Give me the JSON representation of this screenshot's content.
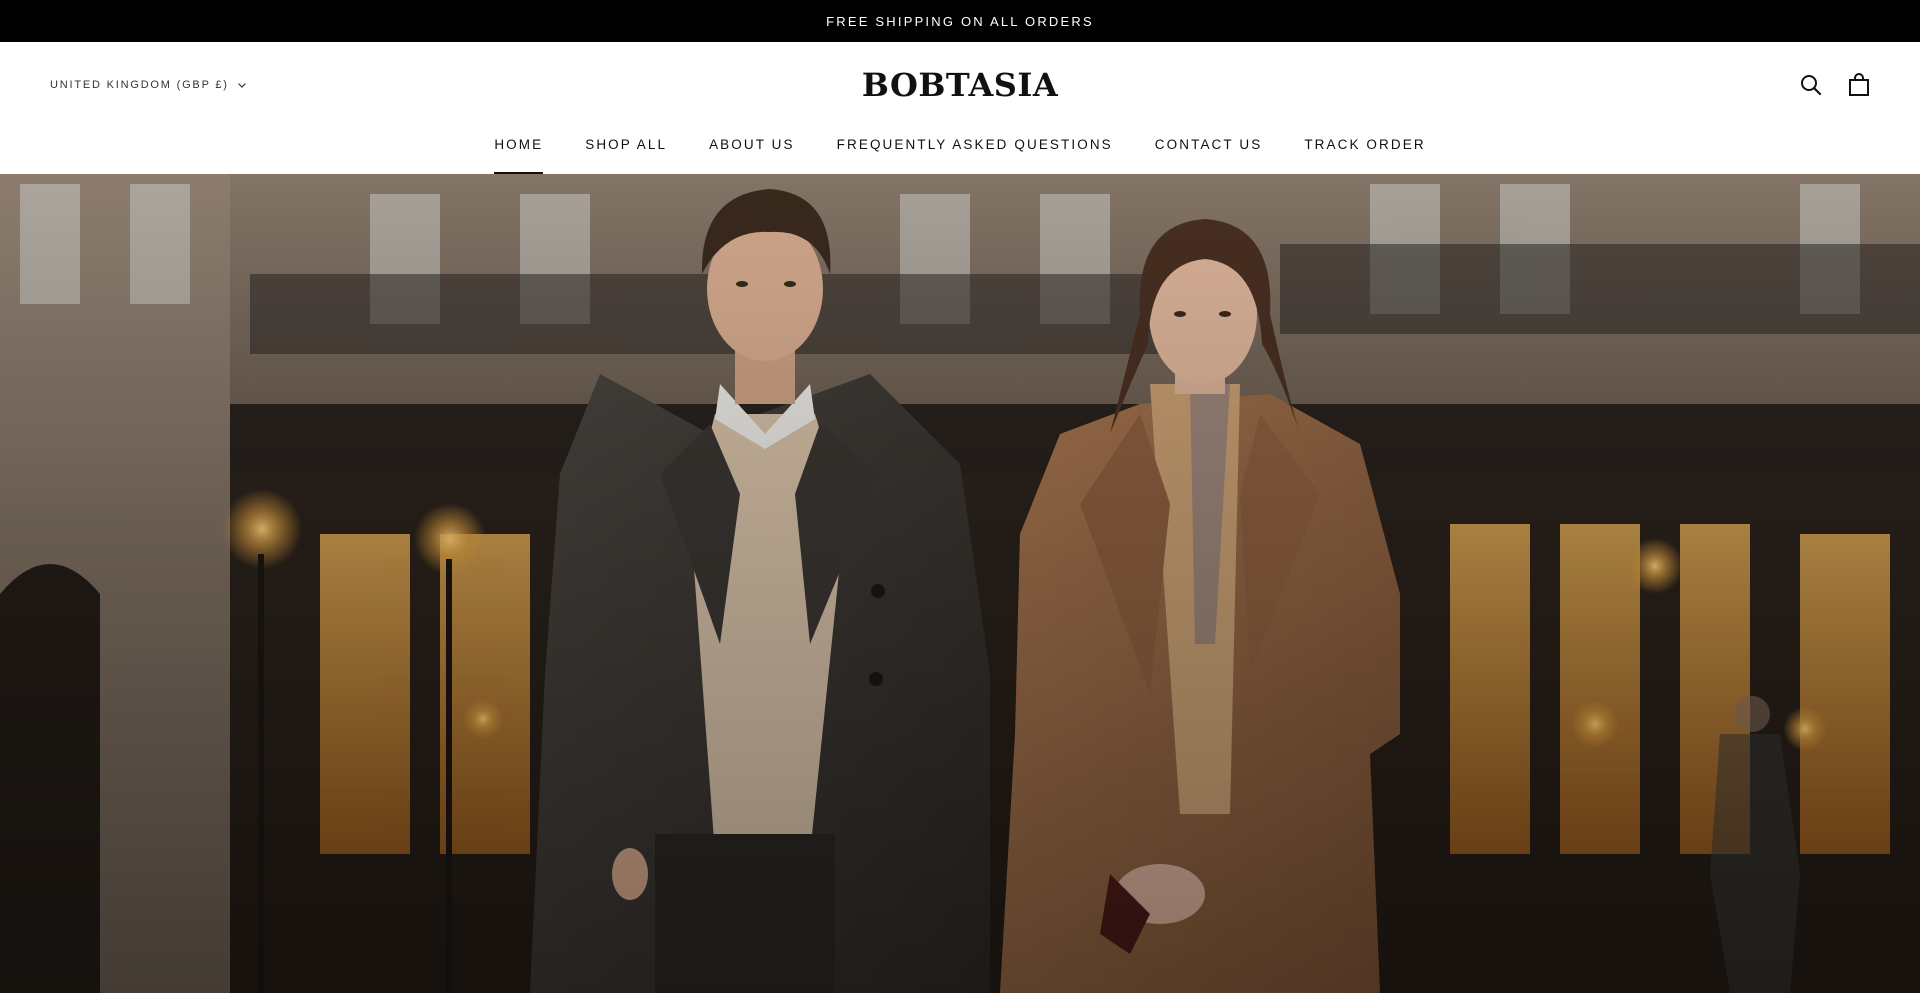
{
  "announcement": {
    "text": "FREE SHIPPING ON ALL ORDERS"
  },
  "header": {
    "currency_selector": "UNITED KINGDOM (GBP £)",
    "logo": "BOBTASIA",
    "icons": [
      "search-icon",
      "cart-icon"
    ]
  },
  "nav": {
    "items": [
      {
        "label": "HOME",
        "active": true
      },
      {
        "label": "SHOP ALL",
        "active": false
      },
      {
        "label": "ABOUT US",
        "active": false
      },
      {
        "label": "FREQUENTLY ASKED QUESTIONS",
        "active": false
      },
      {
        "label": "CONTACT US",
        "active": false
      },
      {
        "label": "TRACK ORDER",
        "active": false
      }
    ]
  },
  "hero": {
    "image_description": "man and woman in winter coats on city street",
    "colors": {
      "mans_coat": "#3a3632",
      "womans_coat": "#9c6b45",
      "window_glow": "#d8962e"
    }
  }
}
